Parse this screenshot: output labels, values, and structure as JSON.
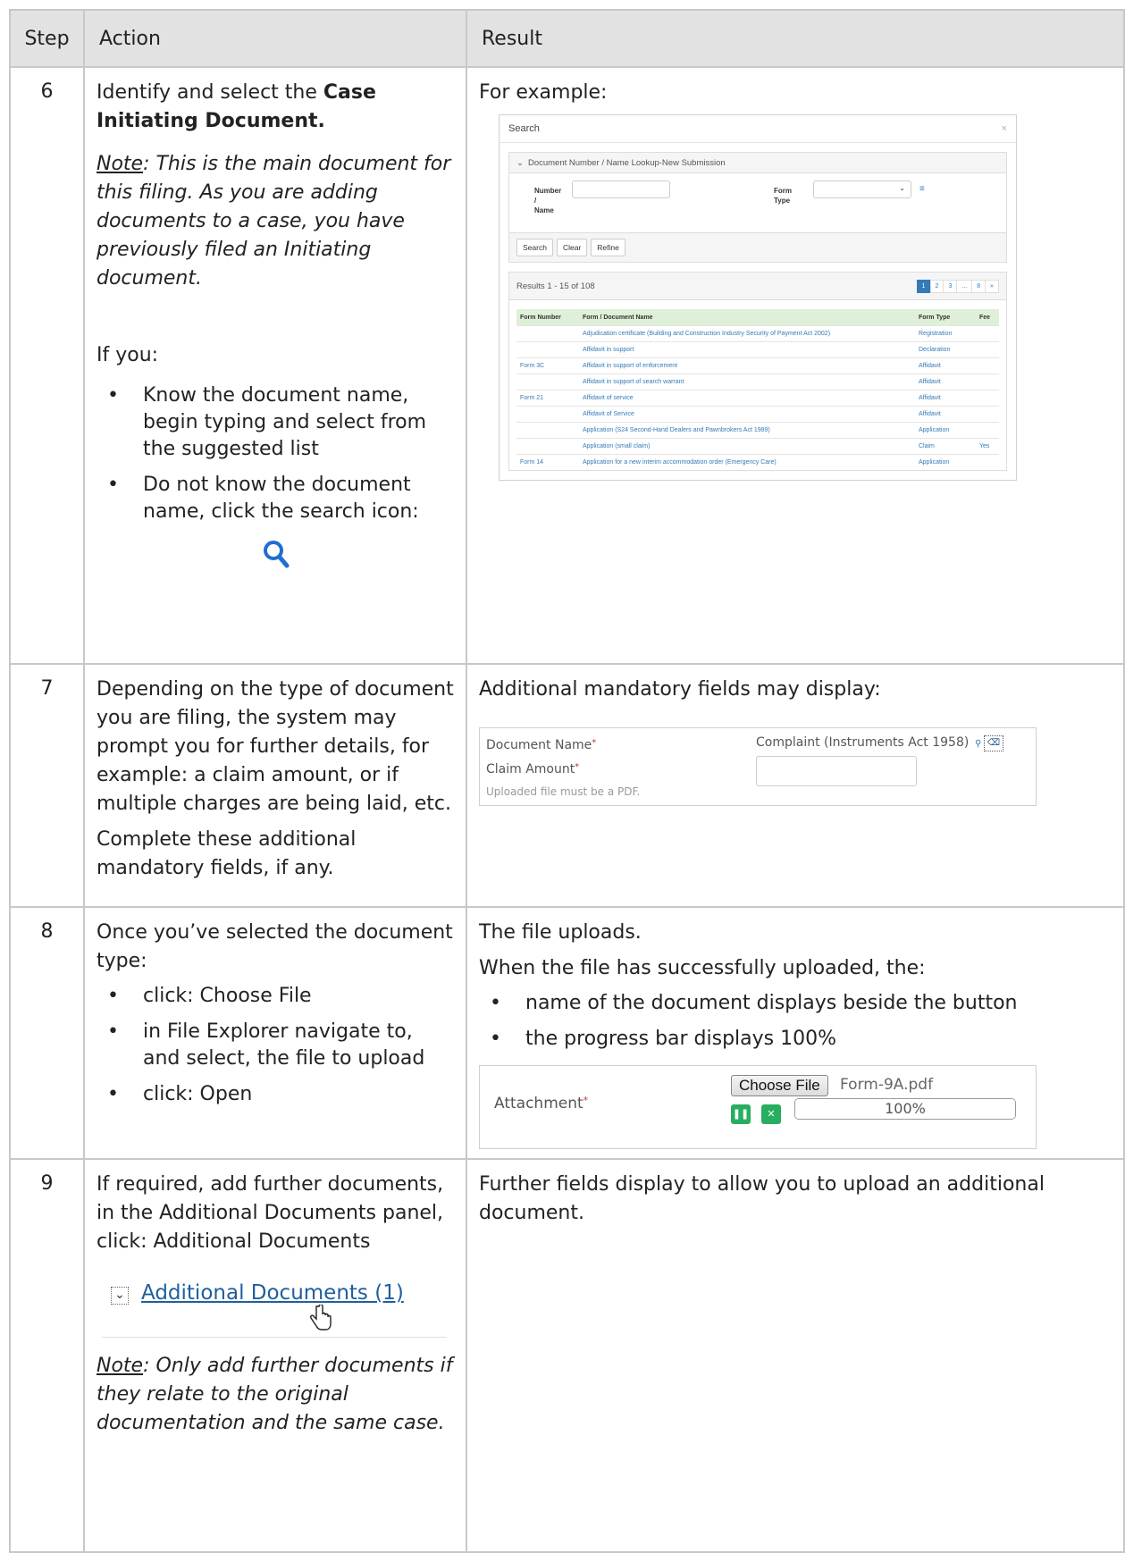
{
  "header": {
    "step": "Step",
    "action": "Action",
    "result": "Result"
  },
  "rows": [
    {
      "step": "6",
      "action": {
        "intro": "Identify and select the ",
        "intro_bold": "Case Initiating Document.",
        "note_label": "Note",
        "note_text": ":  This is the main document for this filing.  As you are adding documents to a case, you have previously filed an Initiating document.",
        "if_you": "If you:",
        "bullets": [
          "Know the document name, begin typing and select from the suggested list",
          "Do not know the document name, click the search icon:"
        ]
      },
      "result": {
        "text": "For example:",
        "dialog": {
          "title": "Search",
          "close": "×",
          "panel_title": "Document Number / Name Lookup-New Submission",
          "number_label": "Number\n/\nName",
          "form_type_label": "Form\nType",
          "buttons": [
            "Search",
            "Clear",
            "Refine"
          ],
          "results_text": "Results 1 - 15 of 108",
          "pages": [
            "1",
            "2",
            "3",
            "...",
            "8",
            "»"
          ],
          "columns": [
            "Form Number",
            "Form / Document Name",
            "Form Type",
            "Fee"
          ],
          "rows": [
            [
              "",
              "Adjudication certificate (Building and Construction Industry Security of Payment Act 2002)",
              "Registration",
              ""
            ],
            [
              "",
              "Affidavit in support",
              "Declaration",
              ""
            ],
            [
              "Form 3C",
              "Affidavit in support of enforcement",
              "Affidavit",
              ""
            ],
            [
              "",
              "Affidavit in support of search warrant",
              "Affidavit",
              ""
            ],
            [
              "Form 21",
              "Affidavit of service",
              "Affidavit",
              ""
            ],
            [
              "",
              "Affidavit of Service",
              "Affidavit",
              ""
            ],
            [
              "",
              "Application (S24 Second-Hand Dealers and Pawnbrokers Act 1989)",
              "Application",
              ""
            ],
            [
              "",
              "Application (small claim)",
              "Claim",
              "Yes"
            ],
            [
              "Form 14",
              "Application for a new interim accommodation order (Emergency Care)",
              "Application",
              ""
            ]
          ]
        }
      }
    },
    {
      "step": "7",
      "action": {
        "p1": "Depending on the type of document you are filing, the system may prompt you for further details, for example:  a claim amount, or if multiple charges are being laid, etc.",
        "p2": "Complete these additional mandatory fields, if any."
      },
      "result": {
        "text": "Additional mandatory fields may display:",
        "doc_name_label": "Document Name",
        "claim_label": "Claim Amount",
        "asterisk": "*",
        "hint": "Uploaded file must be a PDF.",
        "doc_value": "Complaint (Instruments Act 1958)"
      }
    },
    {
      "step": "8",
      "action": {
        "p1": "Once you’ve selected the document type:",
        "bullets": [
          "click:  Choose File",
          "in File Explorer navigate to, and select, the file to upload",
          "click:  Open"
        ]
      },
      "result": {
        "p1": "The file uploads.",
        "p2": "When the file has successfully uploaded, the:",
        "bullets": [
          "name of the document displays beside the button",
          "the progress bar displays 100%"
        ],
        "attachment_label": "Attachment",
        "asterisk": "*",
        "choose_file": "Choose File",
        "file_name": "Form-9A.pdf",
        "progress_text": "100%",
        "progress": 1.0
      }
    },
    {
      "step": "9",
      "action": {
        "p1": "If required, add further documents, in the Additional Documents panel, click:  Additional Documents",
        "panel_label": "Additional Documents  (1)",
        "note_label": "Note",
        "note_text": ": Only add further documents if they relate to the original documentation and the same case."
      },
      "result": {
        "text": "Further fields display to allow you to upload an additional document."
      }
    }
  ]
}
